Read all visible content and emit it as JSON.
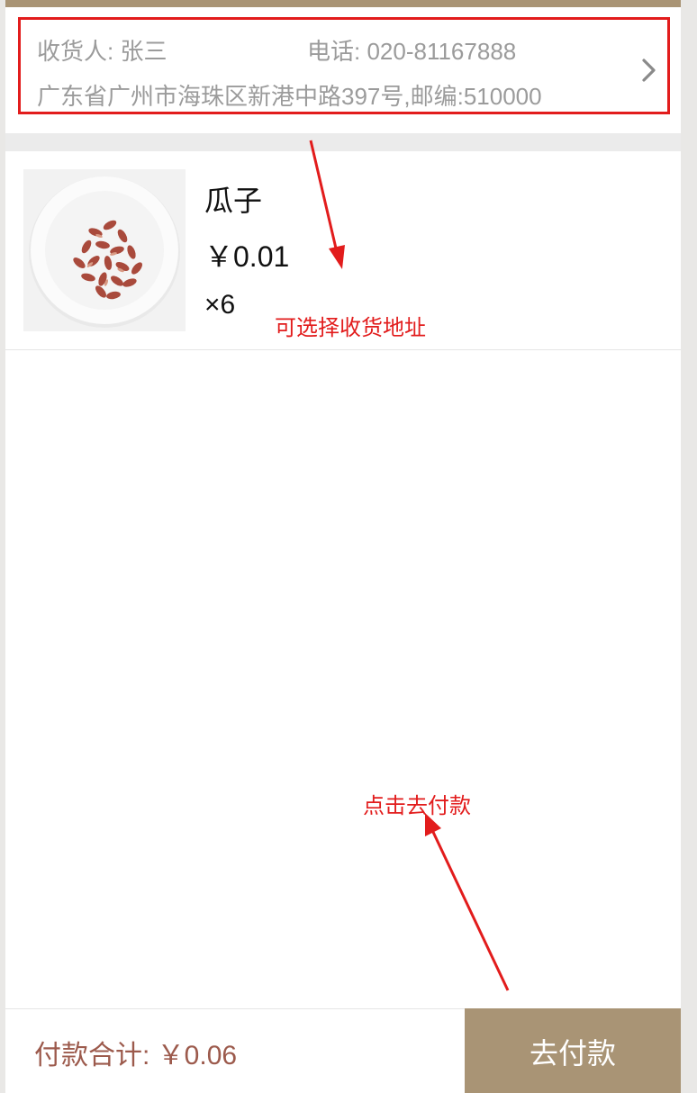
{
  "address": {
    "consignee": "收货人: 张三",
    "phone": "电话: 020-81167888",
    "detail": "广东省广州市海珠区新港中路397号,邮编:510000"
  },
  "item": {
    "name": "瓜子",
    "price": "￥0.01",
    "quantity": "×6",
    "image_icon": "sunflower-seeds-plate-image"
  },
  "annotations": {
    "select_address": "可选择收货地址",
    "click_pay": "点击去付款"
  },
  "footer": {
    "total_label": "付款合计:  ￥0.06",
    "pay_button": "去付款"
  },
  "colors": {
    "accent": "#a99475",
    "total_text": "#9c5a4c",
    "annotation_red": "#e21c1c"
  }
}
